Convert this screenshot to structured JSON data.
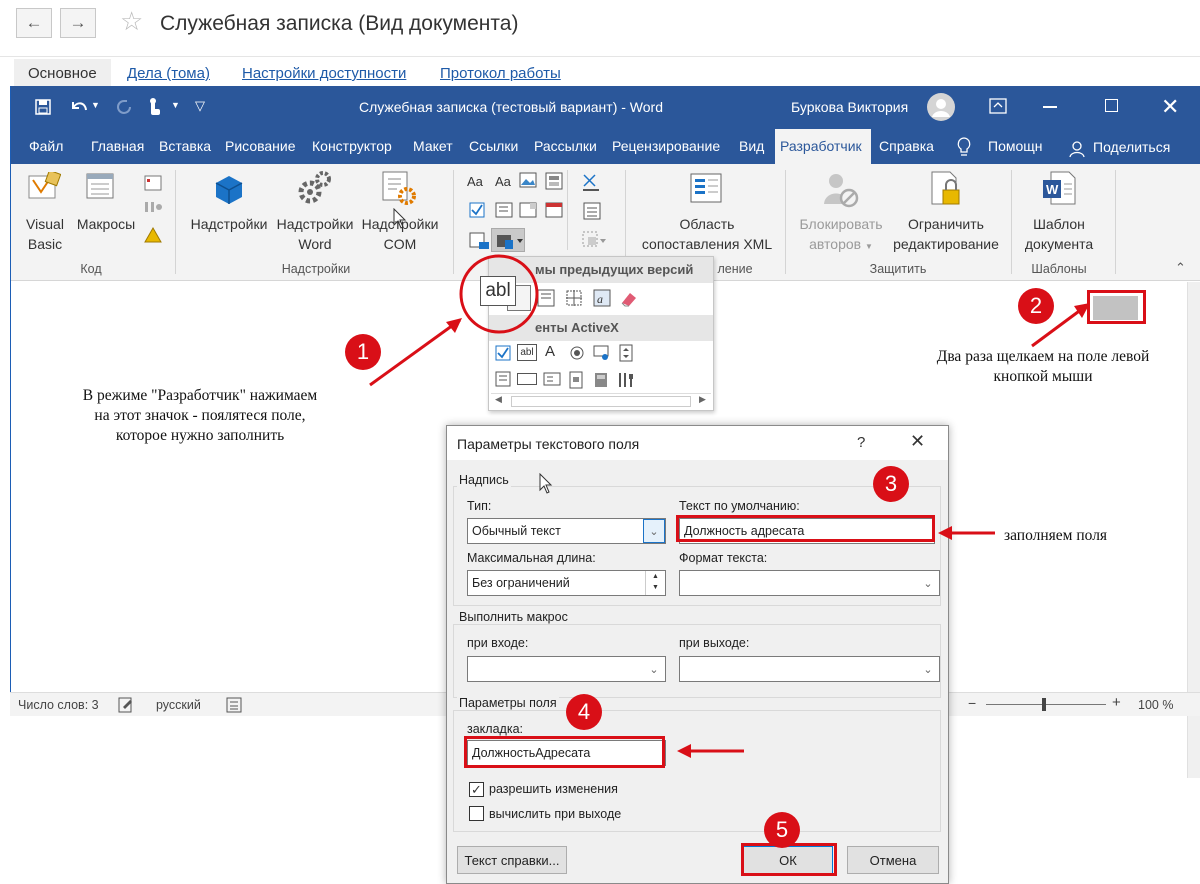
{
  "onec": {
    "title": "Служебная записка (Вид документа)",
    "tabs": [
      "Основное",
      "Дела (тома)",
      "Настройки доступности",
      "Протокол работы"
    ]
  },
  "word": {
    "window_title": "Служебная записка (тестовый вариант)  -  Word",
    "user": "Буркова Виктория",
    "ribbon_tabs": [
      "Файл",
      "Главная",
      "Вставка",
      "Рисование",
      "Конструктор",
      "Макет",
      "Ссылки",
      "Рассылки",
      "Рецензирование",
      "Вид",
      "Разработчик",
      "Справка",
      "Помощн",
      "Поделиться"
    ],
    "ribbon": {
      "visual_basic": "Visual Basic",
      "macros": "Макросы",
      "group_code": "Код",
      "addins": "Надстройки",
      "word_addins_1": "Надстройки",
      "word_addins_2": "Word",
      "com_addins_1": "Надстройки",
      "com_addins_2": "COM",
      "group_addins": "Надстройки",
      "xml_pane_1": "Область",
      "xml_pane_2": "сопоставления XML",
      "group_mapping_tail": "ление",
      "block_authors_1": "Блокировать",
      "block_authors_2": "авторов",
      "restrict_1": "Ограничить",
      "restrict_2": "редактирование",
      "group_protect": "Защитить",
      "template_1": "Шаблон",
      "template_2": "документа",
      "group_templates": "Шаблоны"
    },
    "gallery": {
      "legacy_header": "мы предыдущих версий",
      "activex_header": "енты ActiveX"
    },
    "status": {
      "word_count": "Число слов: 3",
      "language": "русский",
      "zoom": "100 %"
    }
  },
  "dialog": {
    "title": "Параметры текстового поля",
    "help": "?",
    "section_caption": "Надпись",
    "type_label": "Тип:",
    "type_value": "Обычный текст",
    "default_text_label": "Текст по умолчанию:",
    "default_text_value": "Должность адресата",
    "max_length_label": "Максимальная длина:",
    "max_length_value": "Без ограничений",
    "text_format_label": "Формат текста:",
    "text_format_value": "",
    "section_macro": "Выполнить макрос",
    "on_entry_label": "при входе:",
    "on_exit_label": "при выходе:",
    "section_field": "Параметры поля",
    "bookmark_label": "закладка:",
    "bookmark_value": "ДолжностьАдресата",
    "allow_changes_label": "разрешить изменения",
    "allow_changes_checked": true,
    "calc_on_exit_label": "вычислить при выходе",
    "calc_on_exit_checked": false,
    "help_text_button": "Текст справки...",
    "ok_button": "ОК",
    "cancel_button": "Отмена"
  },
  "annotations": {
    "badges": [
      "1",
      "2",
      "3",
      "4",
      "5"
    ],
    "note1": [
      "В режиме \"Разработчик\" нажимаем",
      "на этот значок - поялятеся поле,",
      "которое нужно заполнить"
    ],
    "note2": [
      "Два раза щелкаем на поле левой",
      "кнопкой мыши"
    ],
    "note3": "заполняем поля",
    "color": "#d90f17"
  },
  "colors": {
    "word_blue": "#2b579a",
    "ribbon_bg": "#f3f3f3",
    "link_blue": "#1e5aa8"
  }
}
